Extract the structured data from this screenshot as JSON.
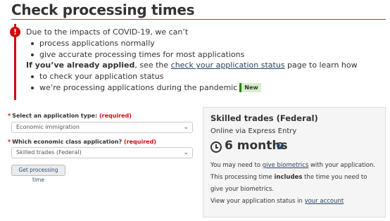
{
  "page": {
    "title": "Check processing times"
  },
  "alert": {
    "icon": "exclamation-icon",
    "intro": "Due to the impacts of COVID-19, we can’t",
    "items1": [
      "process applications normally",
      "give accurate processing times for most applications"
    ],
    "applied_bold": "If you’ve already applied",
    "applied_mid": ", see the ",
    "status_link": "check your application status",
    "applied_end": " page to learn how",
    "items2": [
      "to check your application status",
      "we’re processing applications during the pandemic"
    ],
    "new_badge": "New"
  },
  "form": {
    "app_type_label": "Select an application type:",
    "required": "(required)",
    "app_type_value": "Economic immigration",
    "class_label": "Which economic class application?",
    "class_value": "Skilled trades (Federal)",
    "button_label": "Get processing time"
  },
  "result": {
    "title": "Skilled trades (Federal)",
    "subtitle": "Online via Express Entry",
    "time": "6 months",
    "body_pre": "You may need to ",
    "biometrics_link": "give biometrics",
    "body_mid": " with your application. This processing time ",
    "body_bold": "includes",
    "body_end": " the time you need to give your biometrics.",
    "foot_pre": "View your application status in ",
    "account_link": "your account"
  },
  "colors": {
    "accent_red": "#d3080c",
    "rule": "#af3c43",
    "link": "#284162",
    "new_green": "#278400"
  }
}
